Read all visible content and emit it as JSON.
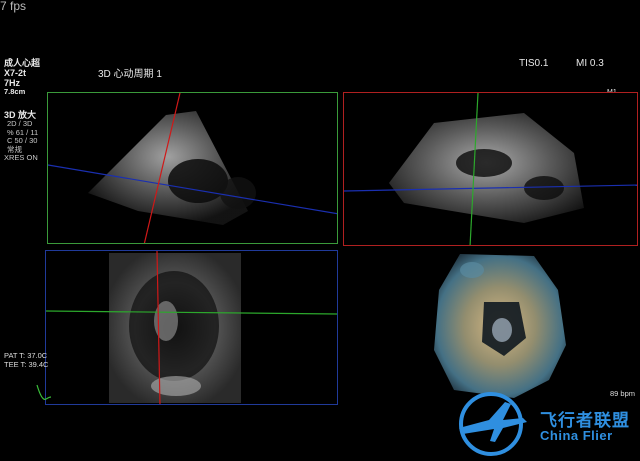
{
  "fps": "7 fps",
  "header": {
    "title_cn": "成人心超",
    "probe": "X7-2t",
    "freq": "7Hz",
    "depth": "7.8cm",
    "mode_label": "3D 心动周期 1",
    "tis": "TIS0.1",
    "mi": "MI 0.3",
    "scale_label": "M1"
  },
  "params": {
    "zoom_title": "3D 放大",
    "lines": [
      "2D / 3D",
      "% 61 / 11",
      "C 50 / 30",
      "常规",
      "XRES ON"
    ]
  },
  "temps": {
    "pat": "PAT T: 37.0C",
    "tee": "TEE T: 39.4C"
  },
  "heart_rate": "89 bpm",
  "watermark": {
    "cn": "飞行者联盟",
    "en": "China Flier"
  },
  "colors": {
    "green_frame": "#3a9a3a",
    "red_frame": "#b02020",
    "blue_frame": "#203a9a",
    "logo_blue": "#2f8fe0"
  }
}
